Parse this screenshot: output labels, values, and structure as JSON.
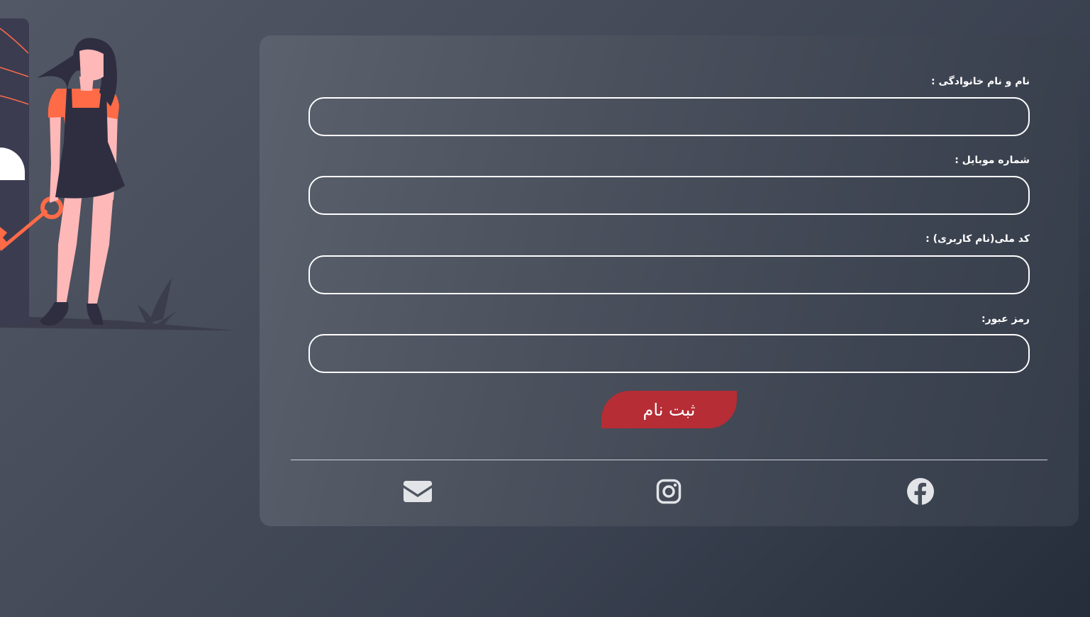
{
  "form": {
    "fields": [
      {
        "label": "نام و نام خانوادگی :",
        "value": "",
        "placeholder": ""
      },
      {
        "label": "شماره موبایل :",
        "value": "",
        "placeholder": ""
      },
      {
        "label": "کد ملی(نام کاربری) :",
        "value": "",
        "placeholder": ""
      },
      {
        "label": "رمز عبور:",
        "value": "",
        "placeholder": ""
      }
    ],
    "submit_label": "ثبت نام"
  },
  "social": [
    {
      "icon": "mail-icon"
    },
    {
      "icon": "instagram-icon"
    },
    {
      "icon": "facebook-icon"
    }
  ],
  "colors": {
    "accent": "#b62d36",
    "illustration_orange": "#ff6b47",
    "illustration_dark": "#2f2e41",
    "skin": "#ffb8b8"
  }
}
